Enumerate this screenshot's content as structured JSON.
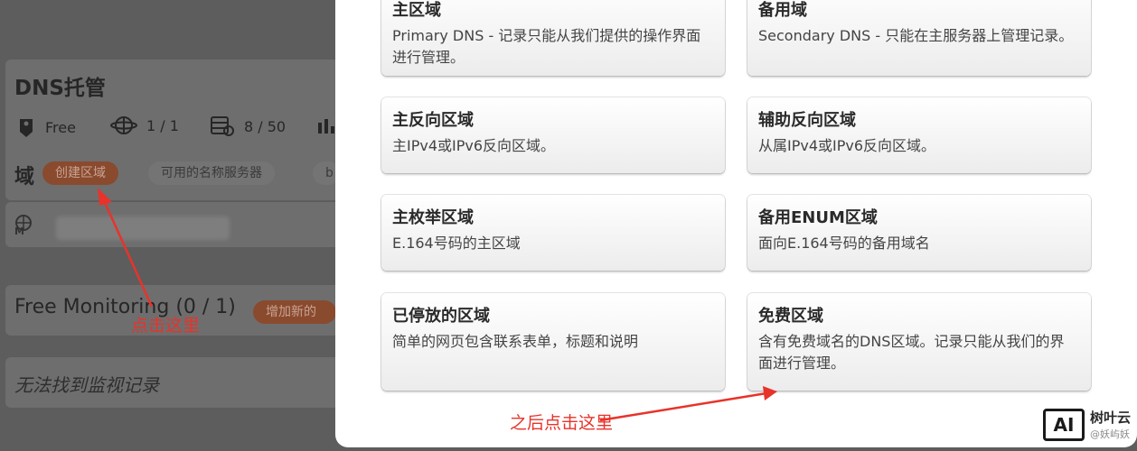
{
  "dashboard": {
    "dns_title": "DNS托管",
    "stats": [
      {
        "icon": "tag-icon",
        "value": "Free"
      },
      {
        "icon": "globe-icon",
        "value": "1 / 1"
      },
      {
        "icon": "server-icon",
        "value": "8 / 50"
      }
    ],
    "zones_heading": "域",
    "create_zone_label": "创建区域",
    "nameservers_label": "可用的名称服务器",
    "partial_pill_label": "b",
    "zone_row_badge": "M",
    "monitoring_title": "Free Monitoring (0 / 1)",
    "add_new_label": "增加新的",
    "monitoring_empty": "无法找到监视记录"
  },
  "modal": {
    "zones": [
      {
        "title": "主区域",
        "desc": "Primary DNS - 记录只能从我们提供的操作界面进行管理。"
      },
      {
        "title": "备用域",
        "desc": "Secondary DNS - 只能在主服务器上管理记录。"
      },
      {
        "title": "主反向区域",
        "desc": "主IPv4或IPv6反向区域。"
      },
      {
        "title": "辅助反向区域",
        "desc": "从属IPv4或IPv6反向区域。"
      },
      {
        "title": "主枚举区域",
        "desc": "E.164号码的主区域"
      },
      {
        "title": "备用ENUM区域",
        "desc": "面向E.164号码的备用域名"
      },
      {
        "title": "已停放的区域",
        "desc": "简单的网页包含联系表单，标题和说明"
      },
      {
        "title": "免费区域",
        "desc": "含有免费域名的DNS区域。记录只能从我们的界面进行管理。"
      }
    ]
  },
  "annotations": {
    "click_here": "点击这里",
    "then_click_here": "之后点击这里",
    "color": "#e8332a"
  },
  "watermark": {
    "logo": "AI",
    "name": "树叶云",
    "sub": "@妖屿妖"
  },
  "colors": {
    "overlay": "#5d5d5d",
    "primary_pill": "#8a4a2e",
    "modal_bg": "#ffffff"
  }
}
